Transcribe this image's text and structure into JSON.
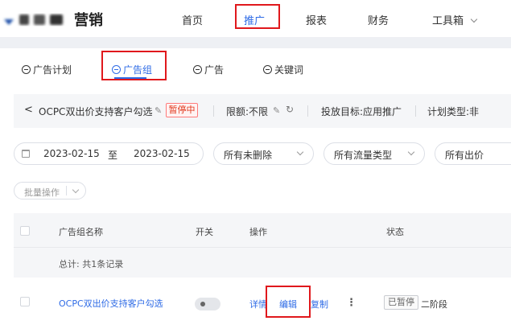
{
  "brand": {
    "name": "营销"
  },
  "nav": {
    "items": [
      {
        "label": "首页"
      },
      {
        "label": "推广"
      },
      {
        "label": "报表"
      },
      {
        "label": "财务"
      },
      {
        "label": "工具箱"
      }
    ]
  },
  "tabs": [
    {
      "label": "广告计划"
    },
    {
      "label": "广告组"
    },
    {
      "label": "广告"
    },
    {
      "label": "关键词"
    }
  ],
  "plan_bar": {
    "back_glyph": "<",
    "plan_name": "OCPC双出价支持客户勾选",
    "status": "暂停中",
    "budget": "限额:不限",
    "goal": "投放目标:应用推广",
    "plan_type": "计划类型:非"
  },
  "filters": {
    "date_start": "2023-02-15",
    "date_to": "至",
    "date_end": "2023-02-15",
    "delete_filter": "所有未删除",
    "traffic_filter": "所有流量类型",
    "bid_filter": "所有出价"
  },
  "batch": {
    "label": "批量操作"
  },
  "table": {
    "columns": [
      "广告组名称",
      "开关",
      "操作",
      "状态"
    ],
    "summary": "总计: 共1条记录",
    "rows": [
      {
        "name": "OCPC双出价支持客户勾选",
        "actions": [
          "详情",
          "编辑",
          "复制"
        ],
        "more": "⋮",
        "status_tag": "已暂停",
        "stage": "二阶段"
      }
    ]
  },
  "colors": {
    "accent": "#2e6be6",
    "highlight_box": "#e0181c",
    "paused": "#e0381c"
  }
}
